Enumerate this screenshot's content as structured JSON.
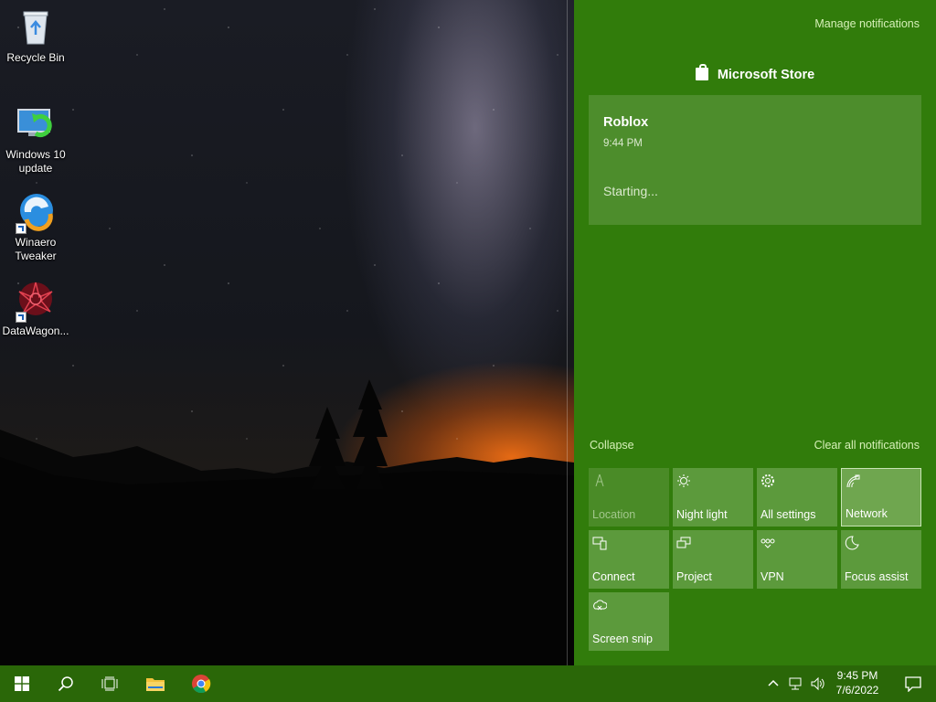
{
  "desktop": {
    "icons": [
      {
        "label": "Recycle Bin",
        "icon": "recycle-bin-icon"
      },
      {
        "label": "Windows 10 update",
        "icon": "windows-update-icon"
      },
      {
        "label": "Winaero Tweaker",
        "icon": "winaero-tweaker-icon"
      },
      {
        "label": "DataWagon...",
        "icon": "datawagon-icon"
      }
    ]
  },
  "action_center": {
    "manage_label": "Manage notifications",
    "group_title": "Microsoft Store",
    "notification": {
      "title": "Roblox",
      "time": "9:44 PM",
      "status": "Starting..."
    },
    "collapse_label": "Collapse",
    "clear_label": "Clear all notifications",
    "tiles": [
      {
        "label": "Location",
        "icon": "location-icon",
        "state": "disabled"
      },
      {
        "label": "Night light",
        "icon": "night-light-icon",
        "state": "off"
      },
      {
        "label": "All settings",
        "icon": "gear-icon",
        "state": "off"
      },
      {
        "label": "Network",
        "icon": "network-icon",
        "state": "active"
      },
      {
        "label": "Connect",
        "icon": "connect-icon",
        "state": "off"
      },
      {
        "label": "Project",
        "icon": "project-icon",
        "state": "off"
      },
      {
        "label": "VPN",
        "icon": "vpn-icon",
        "state": "off"
      },
      {
        "label": "Focus assist",
        "icon": "focus-assist-icon",
        "state": "off"
      },
      {
        "label": "Screen snip",
        "icon": "screen-snip-icon",
        "state": "off"
      }
    ],
    "colors": {
      "panel": "#317c0b",
      "tile": "#5c9a3c",
      "link": "#d6f0b8"
    }
  },
  "taskbar": {
    "buttons": [
      "start-icon",
      "search-icon",
      "task-view-icon",
      "file-explorer-icon",
      "chrome-icon"
    ],
    "tray": [
      "chevron-up-icon",
      "network-tray-icon",
      "volume-icon"
    ],
    "time": "9:45 PM",
    "date": "7/6/2022",
    "color": "#2a6708"
  }
}
